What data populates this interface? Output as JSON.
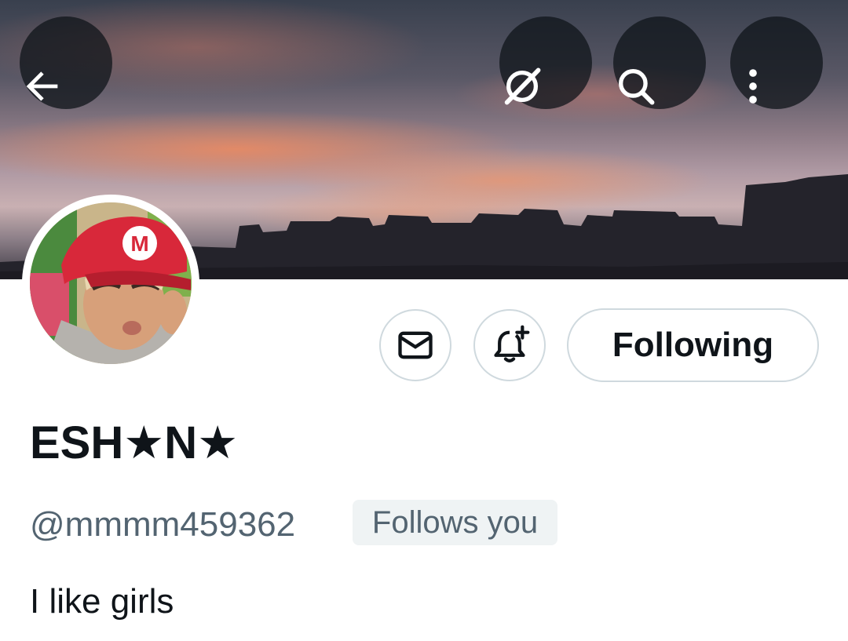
{
  "header": {
    "back_icon": "arrow-left-icon",
    "grok_icon": "grok-slash-icon",
    "search_icon": "search-icon",
    "more_icon": "more-vertical-icon"
  },
  "profile": {
    "name": "ESH★N★",
    "handle": "@mmmm459362",
    "follows_you_badge": "Follows you",
    "bio": "I like girls"
  },
  "actions": {
    "message_icon": "envelope-icon",
    "notify_icon": "bell-plus-icon",
    "following_label": "Following"
  },
  "colors": {
    "text_primary": "#0f1419",
    "text_secondary": "#536471",
    "button_border": "#cfd9de",
    "badge_bg": "#eff3f4"
  }
}
